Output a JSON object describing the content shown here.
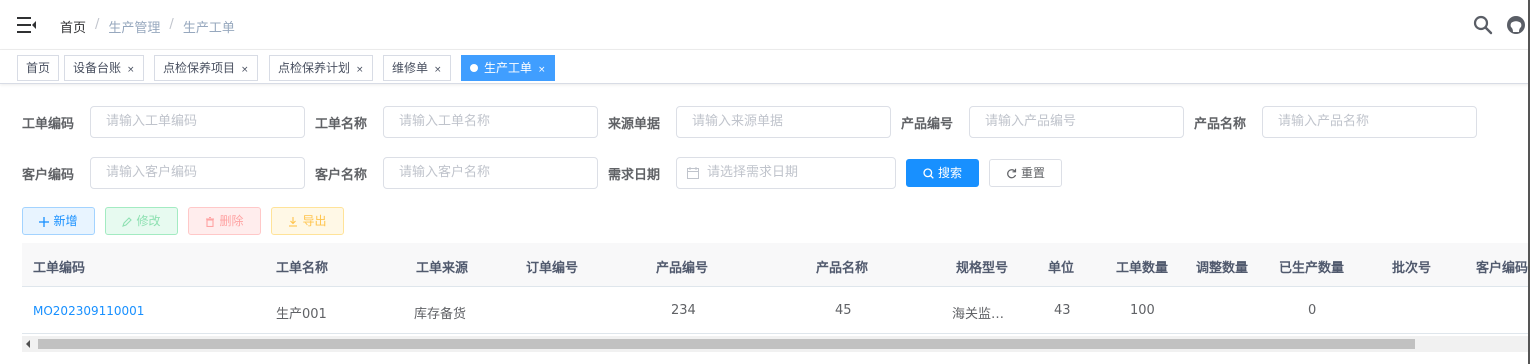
{
  "navbar": {
    "breadcrumb": [
      "首页",
      "生产管理",
      "生产工单"
    ],
    "separator": "/"
  },
  "tags": [
    {
      "label": "首页",
      "closable": false
    },
    {
      "label": "设备台账",
      "closable": true
    },
    {
      "label": "点检保养项目",
      "closable": true
    },
    {
      "label": "点检保养计划",
      "closable": true
    },
    {
      "label": "维修单",
      "closable": true
    },
    {
      "label": "生产工单",
      "closable": true,
      "active": true
    }
  ],
  "tag_close": "×",
  "form": {
    "order_code": {
      "label": "工单编码",
      "placeholder": "请输入工单编码"
    },
    "order_name": {
      "label": "工单名称",
      "placeholder": "请输入工单名称"
    },
    "source_doc": {
      "label": "来源单据",
      "placeholder": "请输入来源单据"
    },
    "product_code": {
      "label": "产品编号",
      "placeholder": "请输入产品编号"
    },
    "product_name": {
      "label": "产品名称",
      "placeholder": "请输入产品名称"
    },
    "client_code": {
      "label": "客户编码",
      "placeholder": "请输入客户编码"
    },
    "client_name": {
      "label": "客户名称",
      "placeholder": "请输入客户名称"
    },
    "request_date": {
      "label": "需求日期",
      "placeholder": "请选择需求日期"
    },
    "search_label": "搜索",
    "reset_label": "重置"
  },
  "toolbar": {
    "add": "新增",
    "edit": "修改",
    "delete": "删除",
    "export": "导出"
  },
  "table": {
    "columns": [
      "工单编码",
      "工单名称",
      "工单来源",
      "订单编号",
      "产品编号",
      "产品名称",
      "规格型号",
      "单位",
      "工单数量",
      "调整数量",
      "已生产数量",
      "批次号",
      "客户编码"
    ],
    "rows": [
      {
        "order_code": "MO202309110001",
        "order_name": "生产001",
        "source": "库存备货",
        "order_no": "",
        "product_code": "234",
        "product_name": "45",
        "spec": "海关监…",
        "unit": "43",
        "quantity": "100",
        "adjust": "",
        "produced": "0",
        "batch": "",
        "client_code": ""
      }
    ]
  },
  "colors": {
    "primary": "#1890ff",
    "active_tag": "#409eff"
  }
}
